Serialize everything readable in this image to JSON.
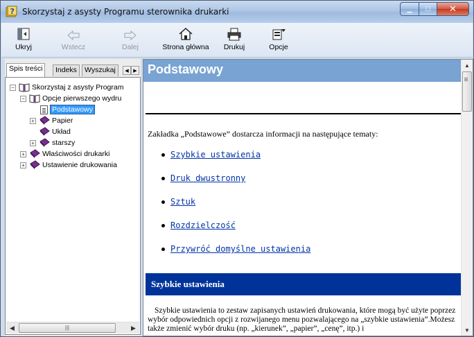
{
  "window": {
    "title": "Skorzystaj z asysty Programu sterownika drukarki",
    "close_glyph": "✕",
    "minimize_glyph": "▁",
    "maximize_glyph": "□"
  },
  "toolbar": {
    "hide_label": "Ukryj",
    "back_label": "Wstecz",
    "forward_label": "Dalej",
    "home_label": "Strona główna",
    "print_label": "Drukuj",
    "options_label": "Opcje"
  },
  "tabs": {
    "contents": "Spis treści",
    "index": "Indeks",
    "search": "Wyszukaj"
  },
  "tree": {
    "root": "Skorzystaj z asysty Program",
    "first_options": "Opcje pierwszego wydru",
    "basic": "Podstawowy",
    "paper": "Papier",
    "layout": "Układ",
    "older": "starszy",
    "printer_props": "Właściwości drukarki",
    "print_settings": "Ustawienie drukowania"
  },
  "content": {
    "page_title": "Podstawowy",
    "intro": "Zakładka „Podstawowe” dostarcza informacji na następujące tematy:",
    "links": [
      "Szybkie ustawienia",
      "Druk dwustronny",
      "Sztuk",
      "Rozdzielczość",
      "Przywróć domyślne ustawienia"
    ],
    "section_title": "Szybkie ustawienia",
    "paragraph": "Szybkie ustawienia to zestaw zapisanych ustawień drukowania, które mogą być użyte poprzez wybór odpowiednich opcji z rozwijanego menu pozwalającego na „szybkie ustawienia”.Możesz także zmienić wybór druku (np. „kierunek”, „papier”, „cenę”, itp.) i"
  },
  "colors": {
    "title_bar": "#9fbbe0",
    "page_title_bg": "#78a3d2",
    "section_bar_bg": "#003399",
    "link": "#0033aa",
    "selection": "#3399ff"
  }
}
